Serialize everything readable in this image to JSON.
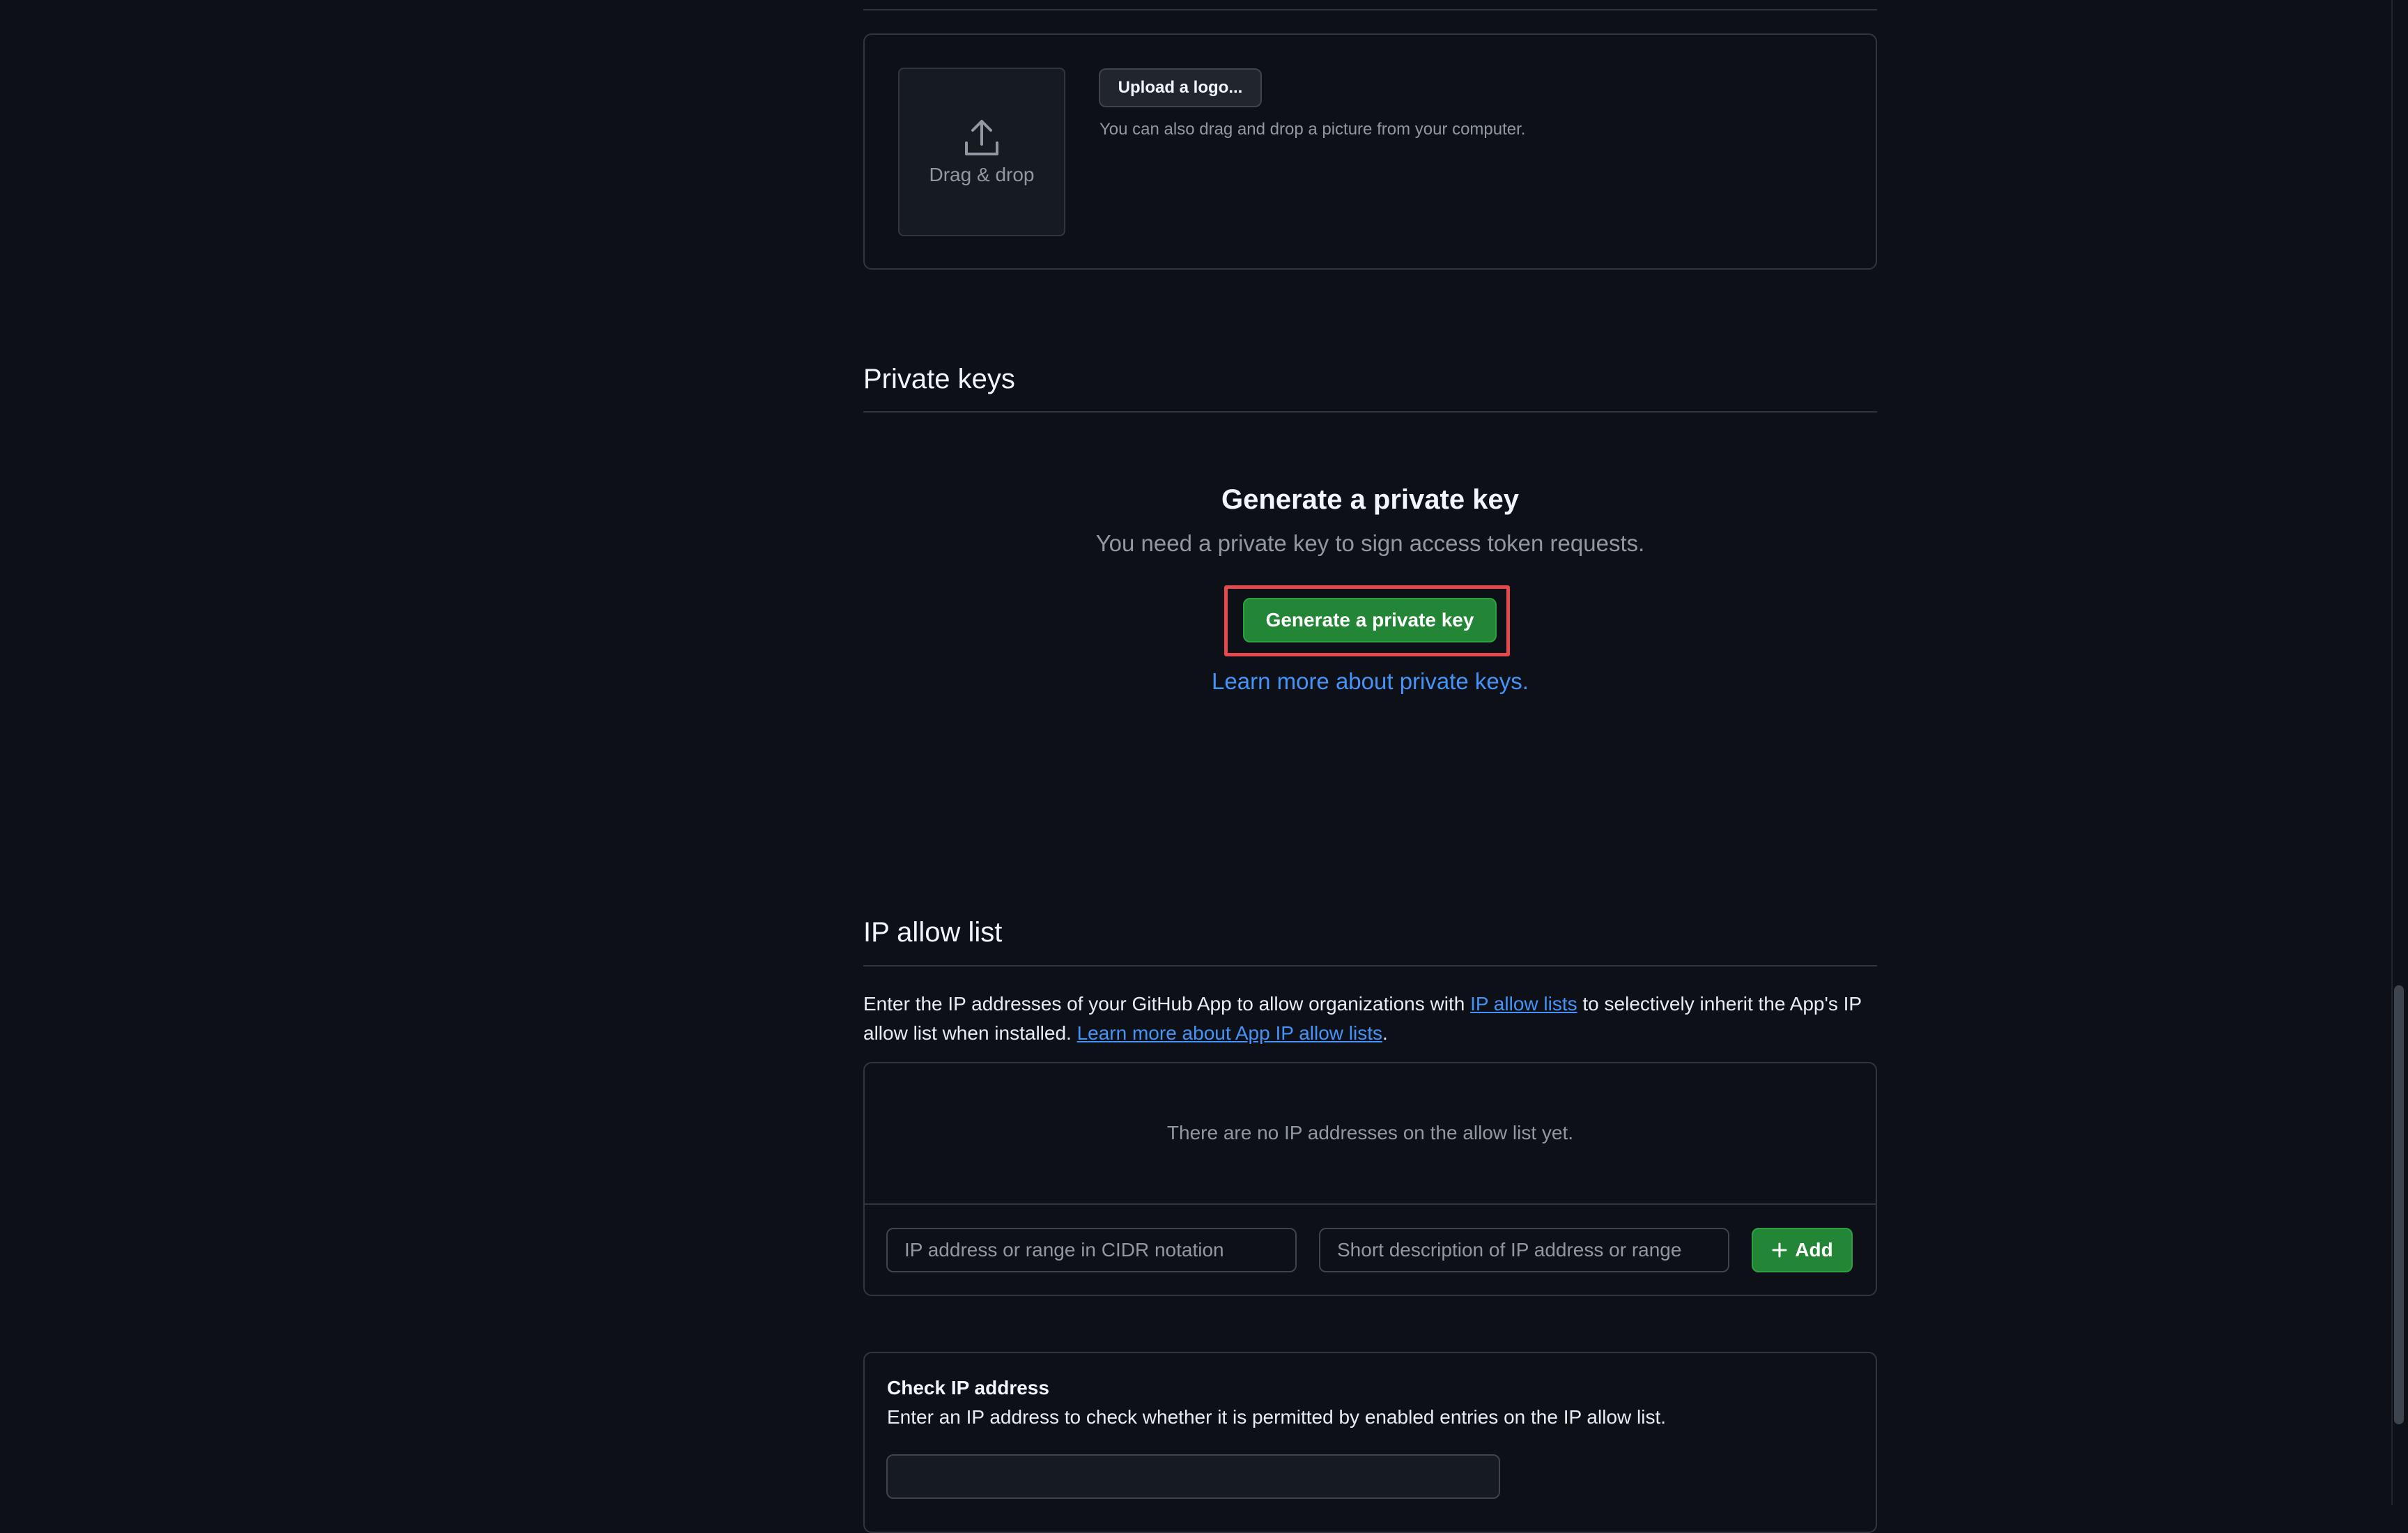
{
  "logo": {
    "dropzone_label": "Drag & drop",
    "upload_button": "Upload a logo...",
    "upload_note": "You can also drag and drop a picture from your computer."
  },
  "private_keys": {
    "section_title": "Private keys",
    "heading": "Generate a private key",
    "description": "You need a private key to sign access token requests.",
    "generate_button": "Generate a private key",
    "learn_more_link": "Learn more about private keys."
  },
  "ip_allow_list": {
    "section_title": "IP allow list",
    "desc_part1": "Enter the IP addresses of your GitHub App to allow organizations with ",
    "desc_link1": "IP allow lists",
    "desc_part2": " to selectively inherit the App's IP allow list when installed. ",
    "desc_link2": "Learn more about App IP allow lists",
    "desc_part3": ".",
    "empty_message": "There are no IP addresses on the allow list yet.",
    "ip_placeholder": "IP address or range in CIDR notation",
    "description_placeholder": "Short description of IP address or range",
    "add_button": "Add"
  },
  "check_ip": {
    "title": "Check IP address",
    "description": "Enter an IP address to check whether it is permitted by enabled entries on the IP allow list.",
    "input_value": ""
  },
  "colors": {
    "background": "#0d1117",
    "primary_button": "#238636",
    "link": "#4493f8",
    "highlight_border": "#e5484d"
  }
}
